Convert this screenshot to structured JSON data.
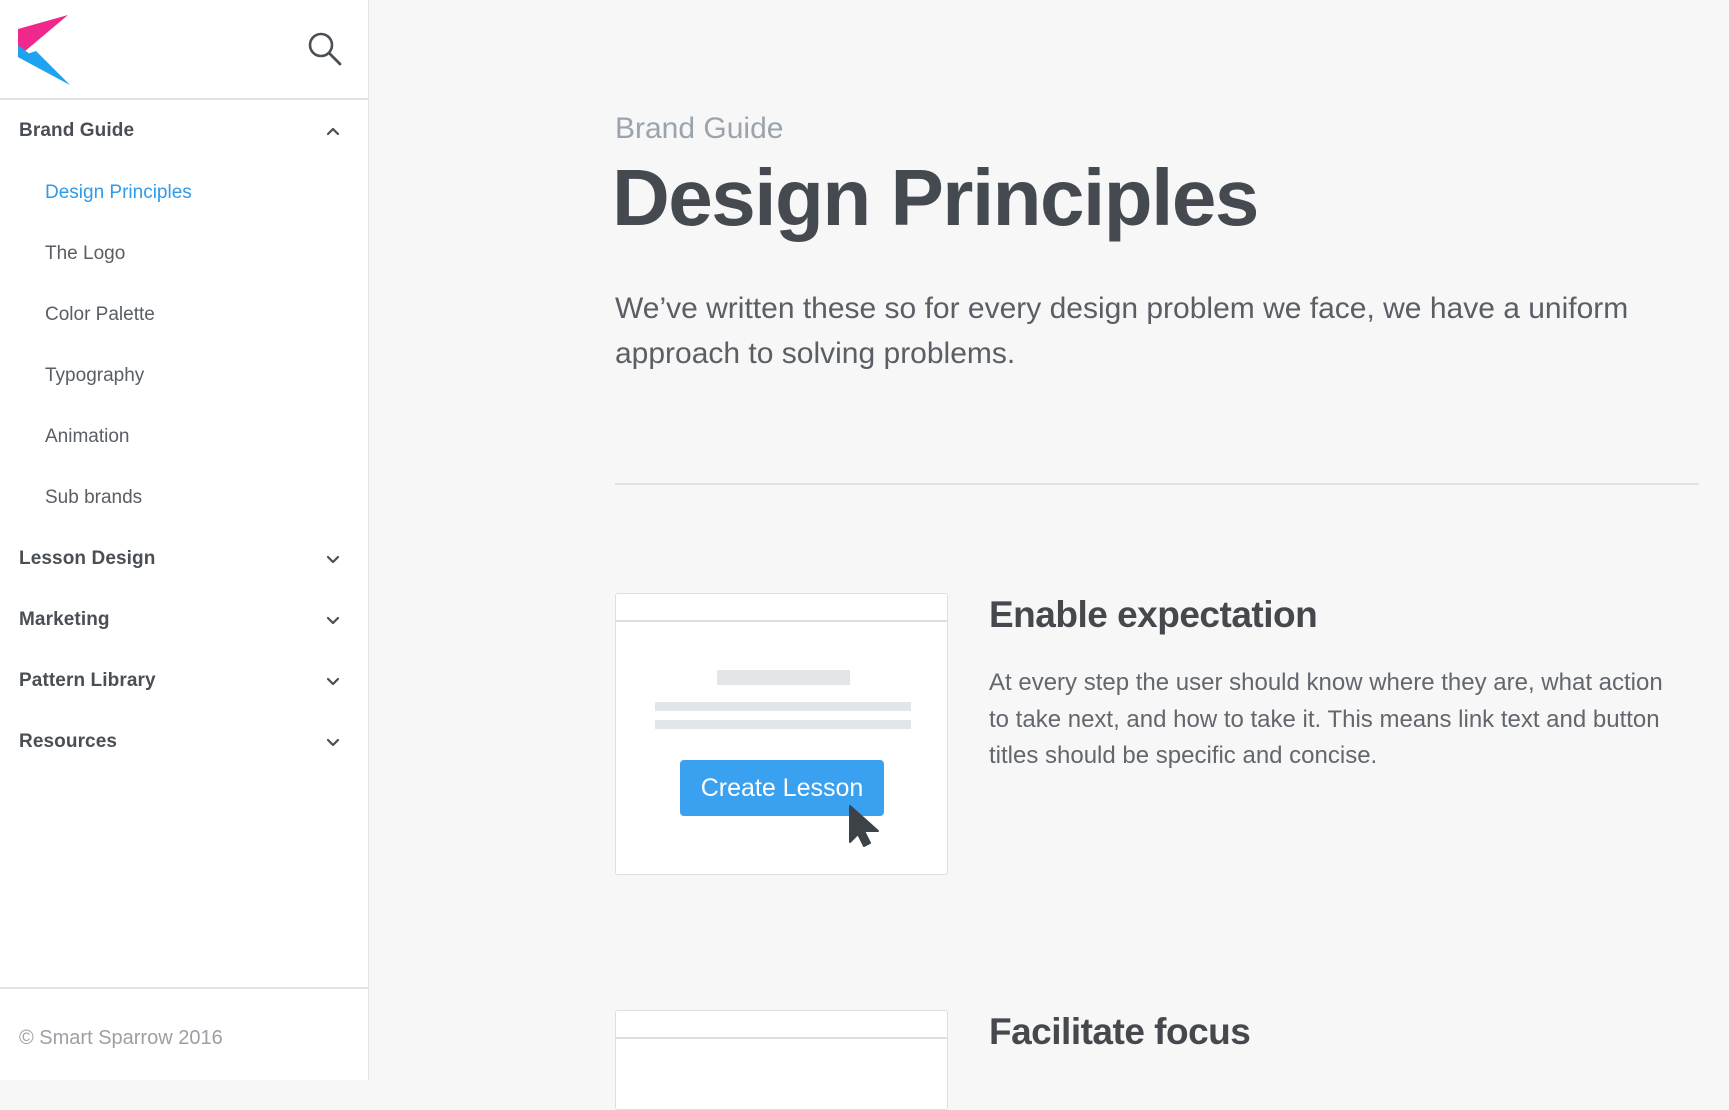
{
  "sidebar": {
    "sections": [
      {
        "label": "Brand Guide",
        "expanded": true
      },
      {
        "label": "Lesson Design",
        "expanded": false
      },
      {
        "label": "Marketing",
        "expanded": false
      },
      {
        "label": "Pattern Library",
        "expanded": false
      },
      {
        "label": "Resources",
        "expanded": false
      }
    ],
    "items": [
      {
        "label": "Design Principles",
        "active": true
      },
      {
        "label": "The Logo",
        "active": false
      },
      {
        "label": "Color Palette",
        "active": false
      },
      {
        "label": "Typography",
        "active": false
      },
      {
        "label": "Animation",
        "active": false
      },
      {
        "label": "Sub brands",
        "active": false
      }
    ],
    "footer": "© Smart Sparrow 2016"
  },
  "main": {
    "breadcrumb": "Brand Guide",
    "title": "Design Principles",
    "intro": "We’ve written these so for every design problem we face, we have a uniform approach to solving problems.",
    "principles": [
      {
        "title": "Enable expectation",
        "body": "At every step the user should know where they are, what action to take next, and how to take it. This means link text and button titles should be specific and concise.",
        "example_button": "Create Lesson"
      },
      {
        "title": "Facilitate focus"
      }
    ]
  },
  "icons": {
    "search": "search-icon",
    "chevron_up": "chevron-up-icon",
    "chevron_down": "chevron-down-icon",
    "logo": "smart-sparrow-logo",
    "cursor": "mouse-pointer-icon"
  },
  "colors": {
    "accent": "#2f9bea",
    "button": "#3aa0f0",
    "logo_pink": "#f0288c",
    "logo_blue": "#1fa2f0",
    "background": "#f7f7f8"
  }
}
